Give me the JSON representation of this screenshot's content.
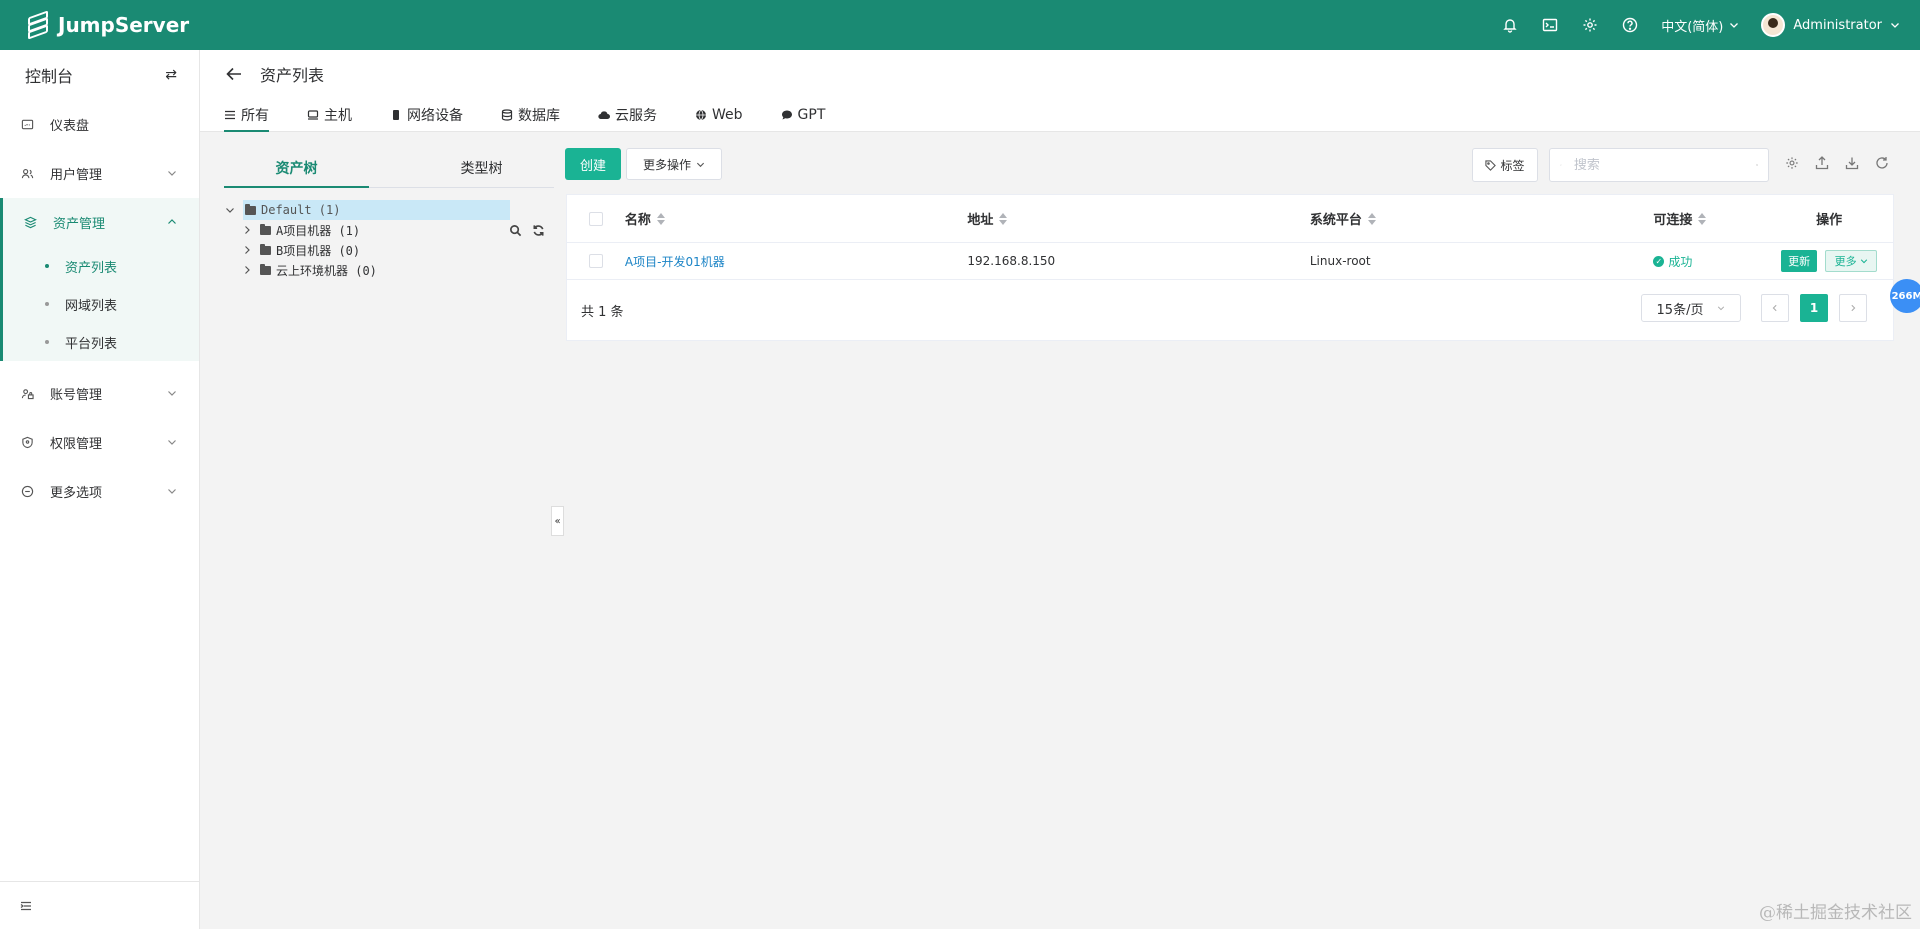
{
  "app": {
    "name": "JumpServer"
  },
  "topbar": {
    "language": "中文(简体)",
    "user": "Administrator",
    "icons": [
      "bell-icon",
      "terminal-icon",
      "gear-icon",
      "help-icon"
    ]
  },
  "sidebar": {
    "title": "控制台",
    "items": [
      {
        "label": "仪表盘",
        "icon": "dashboard-icon"
      },
      {
        "label": "用户管理",
        "icon": "users-icon"
      },
      {
        "label": "资产管理",
        "icon": "layers-icon"
      },
      {
        "label": "账号管理",
        "icon": "accounts-icon"
      },
      {
        "label": "权限管理",
        "icon": "shield-icon"
      },
      {
        "label": "更多选项",
        "icon": "more-icon"
      }
    ],
    "sub_items": [
      {
        "label": "资产列表"
      },
      {
        "label": "网域列表"
      },
      {
        "label": "平台列表"
      }
    ]
  },
  "page": {
    "title": "资产列表",
    "tabs": [
      {
        "label": "所有"
      },
      {
        "label": "主机"
      },
      {
        "label": "网络设备"
      },
      {
        "label": "数据库"
      },
      {
        "label": "云服务"
      },
      {
        "label": "Web"
      },
      {
        "label": "GPT"
      }
    ]
  },
  "tree": {
    "tabs": [
      "资产树",
      "类型树"
    ],
    "root": "Default (1)",
    "children": [
      "A项目机器 (1)",
      "B项目机器 (0)",
      "云上环境机器 (0)"
    ]
  },
  "toolbar": {
    "create": "创建",
    "more": "更多操作",
    "tag": "标签",
    "search_placeholder": "搜索"
  },
  "table": {
    "columns": [
      "名称",
      "地址",
      "系统平台",
      "可连接",
      "操作"
    ],
    "rows": [
      {
        "name": "A项目-开发01机器",
        "address": "192.168.8.150",
        "platform": "Linux-root",
        "connectivity": "成功"
      }
    ],
    "actions": {
      "update": "更新",
      "more": "更多"
    },
    "total": "共 1 条",
    "page_size": "15条/页",
    "current_page": "1"
  },
  "float_badge": "266M",
  "watermark": "@稀土掘金技术社区"
}
